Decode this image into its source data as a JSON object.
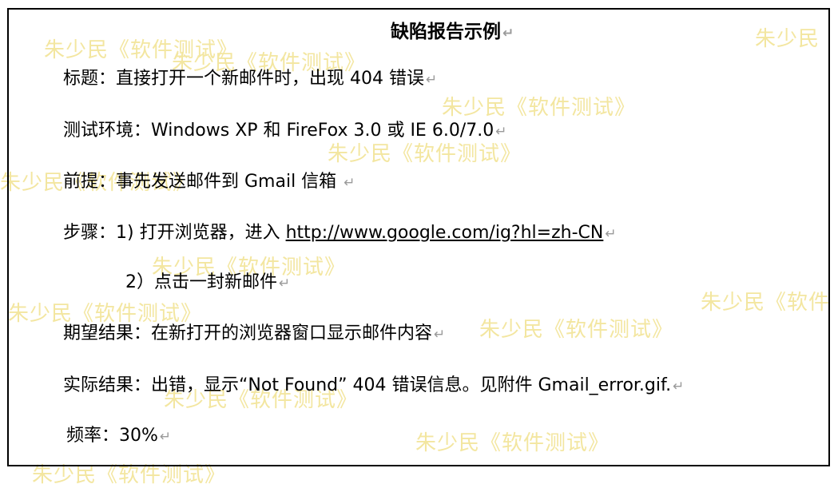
{
  "report": {
    "title": "缺陷报告示例",
    "title_label": "标题：",
    "title_value": "直接打开一个新邮件时，出现 404 错误",
    "env_label": "测试环境：",
    "env_value": "Windows XP  和  FireFox 3.0  或 IE 6.0/7.0",
    "premise_label": "前提：",
    "premise_value": "事先发送邮件到 Gmail 信箱 ",
    "steps_label": "步骤：",
    "step1_text": "1)  打开浏览器，进入 ",
    "step1_link": "http://www.google.com/ig?hl=zh-CN",
    "step2_text": "2）点击一封新邮件",
    "expected_label": "期望结果：",
    "expected_value": "在新打开的浏览器窗口显示邮件内容",
    "actual_label": "实际结果：",
    "actual_value": "出错，显示“Not Found” 404 错误信息。见附件 Gmail_error.gif.",
    "frequency_label": "频率：",
    "frequency_value": "30%",
    "paragraph_mark": "↵"
  },
  "watermark": {
    "text_full": "朱少民《软件测试》",
    "text_short": "朱少民",
    "text_cut": "朱少民《软件",
    "text_tail": "朱少民《软件测试》",
    "color": "#f3e6a0"
  }
}
